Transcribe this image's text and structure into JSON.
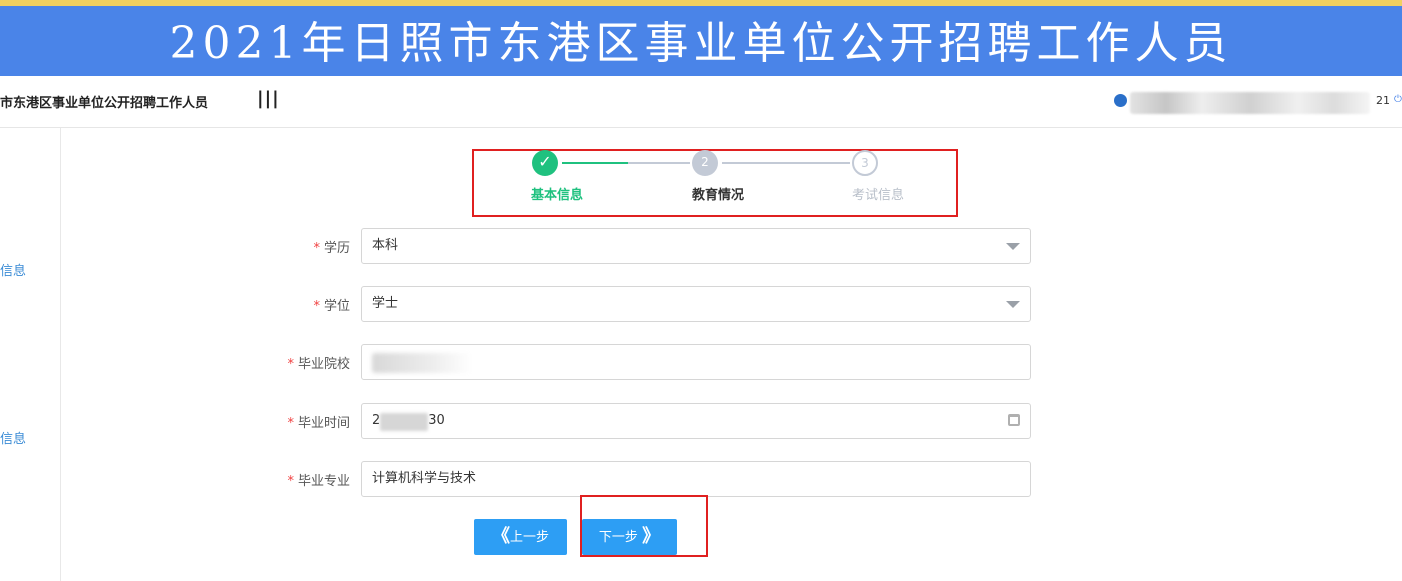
{
  "banner": {
    "title": "2021年日照市东港区事业单位公开招聘工作人员"
  },
  "header": {
    "system_name": "市东港区事业单位公开招聘工作人员",
    "menu_toggle": "|||",
    "user_id_suffix": "21",
    "power_icon": "⏻"
  },
  "sidebar": {
    "items": [
      {
        "label": "信息"
      },
      {
        "label": "信息"
      }
    ]
  },
  "steps": [
    {
      "label": "基本信息",
      "status": "done",
      "number": "✓"
    },
    {
      "label": "教育情况",
      "status": "active",
      "number": "2"
    },
    {
      "label": "考试信息",
      "status": "pending",
      "number": "3"
    }
  ],
  "form": {
    "required_mark": "*",
    "fields": [
      {
        "label": "学历",
        "value": "本科",
        "type": "select"
      },
      {
        "label": "学位",
        "value": "学士",
        "type": "select"
      },
      {
        "label": "毕业院校",
        "value": "",
        "type": "text"
      },
      {
        "label": "毕业时间",
        "value_prefix": "2",
        "value_suffix": "30",
        "type": "date"
      },
      {
        "label": "毕业专业",
        "value": "计算机科学与技术",
        "type": "text"
      }
    ]
  },
  "buttons": {
    "prev": {
      "icon": "《",
      "label": "上一步"
    },
    "next": {
      "label": "下一步",
      "icon": "》"
    }
  },
  "colors": {
    "banner": "#4a84e8",
    "accent": "#2d9ef4",
    "success": "#1fc17f",
    "highlight": "#e02020"
  }
}
